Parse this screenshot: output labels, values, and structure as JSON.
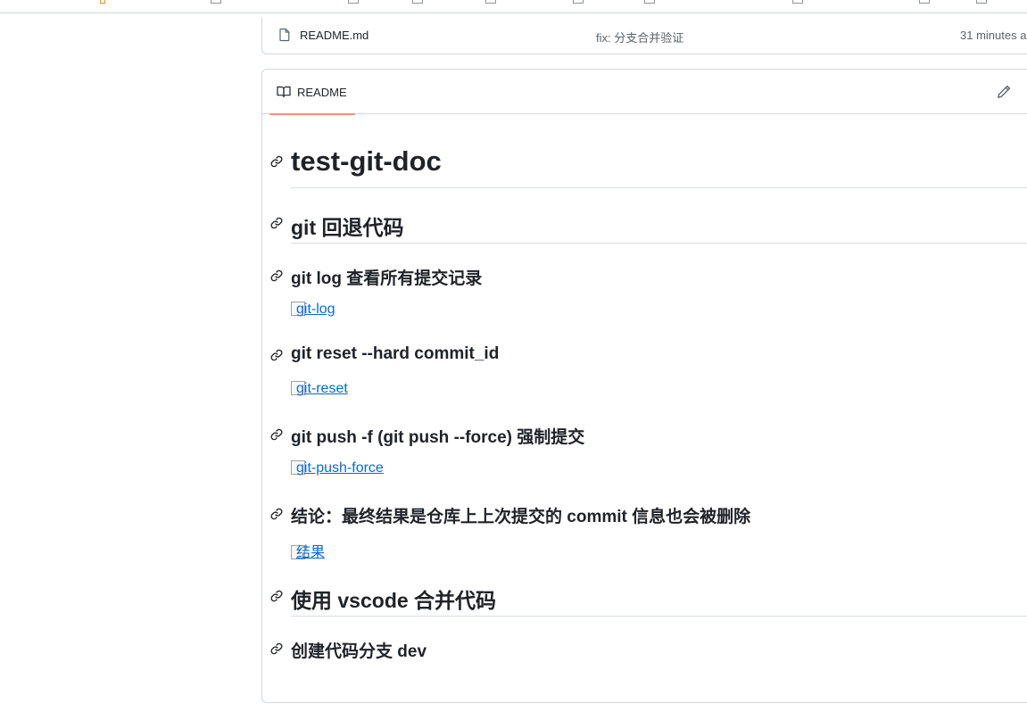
{
  "file_row": {
    "name": "README.md",
    "commit_message": "fix: 分支合并验证",
    "time": "31 minutes a"
  },
  "readme": {
    "tab_label": "README",
    "content": {
      "h_title": "test-git-doc",
      "h_rollback": "git 回退代码",
      "h_log": "git log 查看所有提交记录",
      "img_log": "git-log",
      "h_reset": "git reset --hard commit_id",
      "img_reset": "git-reset",
      "h_push": "git push -f (git push --force) 强制提交",
      "img_push": "git-push-force",
      "h_conclusion": "结论：最终结果是仓库上上次提交的 commit 信息也会被删除",
      "img_result": "结果",
      "h_vscode": "使用 vscode 合并代码",
      "h_branch": "创建代码分支 dev"
    }
  },
  "icons": {
    "file": "file-icon",
    "book": "book-icon",
    "edit": "pencil-icon",
    "anchor": "link-icon"
  },
  "colors": {
    "link": "#0969da",
    "tab_underline": "#fd8c73",
    "border": "#d0d7de",
    "muted_text": "#59636e"
  }
}
